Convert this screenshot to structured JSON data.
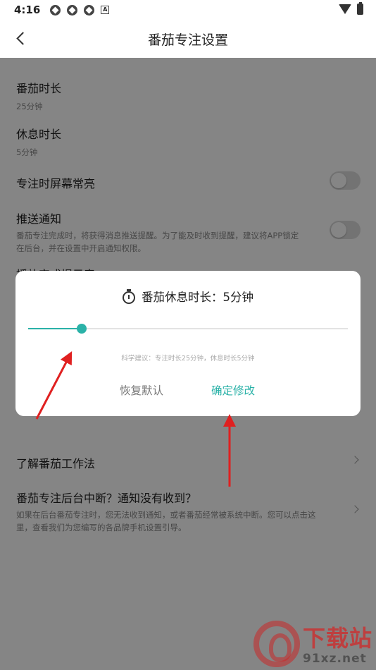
{
  "status": {
    "time": "4:16"
  },
  "appbar": {
    "title": "番茄专注设置"
  },
  "settings": {
    "focus_duration": {
      "label": "番茄时长",
      "value": "25分钟"
    },
    "rest_duration": {
      "label": "休息时长",
      "value": "5分钟"
    },
    "keep_screen_on": {
      "label": "专注时屏幕常亮",
      "enabled": false
    },
    "push_notify": {
      "label": "推送通知",
      "desc": "番茄专注完成时，将获得消息推送提醒。为了能及时收到提醒，建议将APP锁定在后台，并在设置中开启通知权限。",
      "enabled": false
    },
    "partial_label": "播放完成提示音",
    "learn": {
      "label": "了解番茄工作法"
    },
    "background_help": {
      "label": "番茄专注后台中断？通知没有收到？",
      "desc": "如果在后台番茄专注时，您无法收到通知，或者番茄经常被系统中断。您可以点击这里，查看我们为您编写的各品牌手机设置引导。"
    }
  },
  "dialog": {
    "title": "番茄休息时长：5分钟",
    "slider": {
      "value": 5,
      "min": 0,
      "max": 30
    },
    "hint": "科学建议：专注时长25分钟，休息时长5分钟",
    "reset_label": "恢复默认",
    "confirm_label": "确定修改"
  },
  "colors": {
    "accent": "#2bb2a8",
    "arrow": "#e02020"
  },
  "watermark": {
    "text": "下载站",
    "url": "91xz.net"
  }
}
